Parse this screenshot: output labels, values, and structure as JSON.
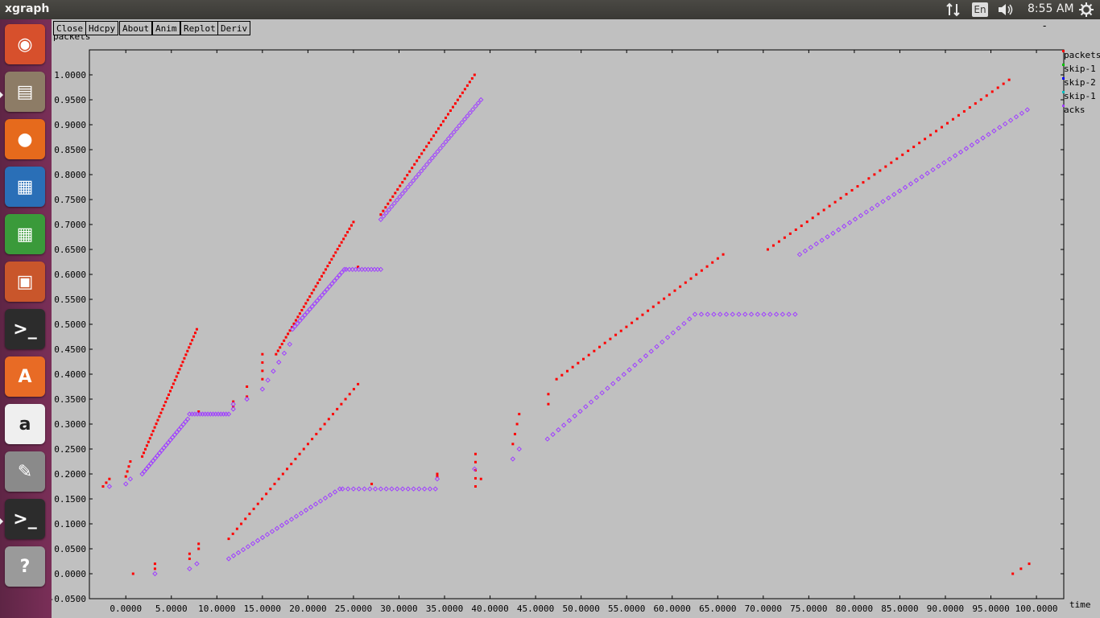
{
  "window": {
    "title": "xgraph"
  },
  "tray": {
    "keyboard": "En",
    "clock": "8:55 AM"
  },
  "launcher": {
    "items": [
      {
        "name": "ubuntu-dash-icon",
        "color": "#d7502c"
      },
      {
        "name": "files-icon",
        "color": "#8d7c66"
      },
      {
        "name": "firefox-icon",
        "color": "#e66a1c"
      },
      {
        "name": "writer-icon",
        "color": "#2a6fb7"
      },
      {
        "name": "calc-icon",
        "color": "#3a9a3a"
      },
      {
        "name": "impress-icon",
        "color": "#c9562b"
      },
      {
        "name": "terminal-icon",
        "color": "#2c2c2c"
      },
      {
        "name": "software-center-icon",
        "color": "#e86b25"
      },
      {
        "name": "amazon-icon",
        "color": "#efefef"
      },
      {
        "name": "system-settings-icon",
        "color": "#8a8a8a"
      },
      {
        "name": "terminal-icon-2",
        "color": "#2c2c2c"
      },
      {
        "name": "help-icon",
        "color": "#9a9a9a"
      }
    ]
  },
  "buttons": {
    "close": "Close",
    "hdcpy": "Hdcpy",
    "about": "About",
    "anim": "Anim",
    "replot": "Replot",
    "deriv": "Deriv"
  },
  "minimize_mark": "-",
  "chart_data": {
    "type": "scatter",
    "ylabel": "packets",
    "xlabel": "time",
    "xlim": [
      -4.0,
      103.0
    ],
    "ylim": [
      -0.05,
      1.05
    ],
    "x_ticks": [
      "0.0000",
      "5.0000",
      "10.0000",
      "15.0000",
      "20.0000",
      "25.0000",
      "30.0000",
      "35.0000",
      "40.0000",
      "45.0000",
      "50.0000",
      "55.0000",
      "60.0000",
      "65.0000",
      "70.0000",
      "75.0000",
      "80.0000",
      "85.0000",
      "90.0000",
      "95.0000",
      "100.0000"
    ],
    "x_tick_values": [
      0,
      5,
      10,
      15,
      20,
      25,
      30,
      35,
      40,
      45,
      50,
      55,
      60,
      65,
      70,
      75,
      80,
      85,
      90,
      95,
      100
    ],
    "y_ticks": [
      "-0.0500",
      "0.0000",
      "0.0500",
      "0.1000",
      "0.1500",
      "0.2000",
      "0.2500",
      "0.3000",
      "0.3500",
      "0.4000",
      "0.4500",
      "0.5000",
      "0.5500",
      "0.6000",
      "0.6500",
      "0.7000",
      "0.7500",
      "0.8000",
      "0.8500",
      "0.9000",
      "0.9500",
      "1.0000"
    ],
    "y_tick_values": [
      -0.05,
      0,
      0.05,
      0.1,
      0.15,
      0.2,
      0.25,
      0.3,
      0.35,
      0.4,
      0.45,
      0.5,
      0.55,
      0.6,
      0.65,
      0.7,
      0.75,
      0.8,
      0.85,
      0.9,
      0.95,
      1.0
    ],
    "legend": [
      {
        "name": "packets",
        "color": "#ff0000"
      },
      {
        "name": "skip-1",
        "color": "#00c000"
      },
      {
        "name": "skip-2",
        "color": "#0000ff"
      },
      {
        "name": "skip-1",
        "color": "#00c0c0"
      },
      {
        "name": "acks",
        "color": "#a040ff"
      }
    ],
    "legend_position": "right",
    "series": [
      {
        "name": "packets",
        "color": "#ff0000",
        "marker": "square",
        "segments": [
          {
            "x0": -2.5,
            "y0": 0.175,
            "x1": -1.8,
            "y1": 0.19,
            "n": 3
          },
          {
            "x0": 0.0,
            "y0": 0.195,
            "x1": 0.5,
            "y1": 0.225,
            "n": 4
          },
          {
            "x0": 1.8,
            "y0": 0.235,
            "x1": 7.8,
            "y1": 0.49,
            "n": 36
          },
          {
            "x0": 8.0,
            "y0": 0.325,
            "x1": 8.0,
            "y1": 0.325,
            "n": 1
          },
          {
            "x0": 0.8,
            "y0": 0.0,
            "x1": 0.8,
            "y1": 0.0,
            "n": 1
          },
          {
            "x0": 3.2,
            "y0": 0.01,
            "x1": 3.2,
            "y1": 0.02,
            "n": 2
          },
          {
            "x0": 7.0,
            "y0": 0.03,
            "x1": 7.0,
            "y1": 0.04,
            "n": 2
          },
          {
            "x0": 8.0,
            "y0": 0.05,
            "x1": 8.0,
            "y1": 0.06,
            "n": 2
          },
          {
            "x0": 11.3,
            "y0": 0.07,
            "x1": 25.5,
            "y1": 0.38,
            "n": 32
          },
          {
            "x0": 11.8,
            "y0": 0.335,
            "x1": 11.8,
            "y1": 0.345,
            "n": 2
          },
          {
            "x0": 13.3,
            "y0": 0.355,
            "x1": 13.3,
            "y1": 0.375,
            "n": 2
          },
          {
            "x0": 15.0,
            "y0": 0.39,
            "x1": 15.0,
            "y1": 0.44,
            "n": 4
          },
          {
            "x0": 16.5,
            "y0": 0.44,
            "x1": 25.0,
            "y1": 0.705,
            "n": 40
          },
          {
            "x0": 25.5,
            "y0": 0.615,
            "x1": 25.5,
            "y1": 0.615,
            "n": 1
          },
          {
            "x0": 28.0,
            "y0": 0.72,
            "x1": 38.3,
            "y1": 1.0,
            "n": 40
          },
          {
            "x0": 27.0,
            "y0": 0.18,
            "x1": 27.0,
            "y1": 0.18,
            "n": 1
          },
          {
            "x0": 34.2,
            "y0": 0.195,
            "x1": 34.2,
            "y1": 0.2,
            "n": 2
          },
          {
            "x0": 38.4,
            "y0": 0.175,
            "x1": 38.4,
            "y1": 0.24,
            "n": 5
          },
          {
            "x0": 39.0,
            "y0": 0.19,
            "x1": 39.0,
            "y1": 0.19,
            "n": 1
          },
          {
            "x0": 42.5,
            "y0": 0.26,
            "x1": 43.2,
            "y1": 0.32,
            "n": 4
          },
          {
            "x0": 46.4,
            "y0": 0.34,
            "x1": 46.4,
            "y1": 0.36,
            "n": 2
          },
          {
            "x0": 47.3,
            "y0": 0.39,
            "x1": 65.6,
            "y1": 0.64,
            "n": 32
          },
          {
            "x0": 70.5,
            "y0": 0.65,
            "x1": 97.0,
            "y1": 0.99,
            "n": 44
          },
          {
            "x0": 97.4,
            "y0": 0.0,
            "x1": 99.2,
            "y1": 0.02,
            "n": 3
          }
        ]
      },
      {
        "name": "acks",
        "color": "#a040ff",
        "marker": "diamond",
        "segments": [
          {
            "x0": -1.8,
            "y0": 0.175,
            "x1": -1.8,
            "y1": 0.175,
            "n": 1
          },
          {
            "x0": 0.0,
            "y0": 0.18,
            "x1": 0.5,
            "y1": 0.19,
            "n": 2
          },
          {
            "x0": 1.8,
            "y0": 0.2,
            "x1": 6.8,
            "y1": 0.31,
            "n": 22
          },
          {
            "x0": 7.0,
            "y0": 0.32,
            "x1": 11.3,
            "y1": 0.32,
            "n": 16
          },
          {
            "x0": 11.8,
            "y0": 0.33,
            "x1": 11.8,
            "y1": 0.34,
            "n": 2
          },
          {
            "x0": 3.2,
            "y0": 0.0,
            "x1": 3.2,
            "y1": 0.0,
            "n": 1
          },
          {
            "x0": 7.0,
            "y0": 0.01,
            "x1": 7.0,
            "y1": 0.01,
            "n": 1
          },
          {
            "x0": 7.8,
            "y0": 0.02,
            "x1": 7.8,
            "y1": 0.02,
            "n": 1
          },
          {
            "x0": 11.3,
            "y0": 0.03,
            "x1": 23.5,
            "y1": 0.17,
            "n": 24
          },
          {
            "x0": 23.8,
            "y0": 0.17,
            "x1": 34.0,
            "y1": 0.17,
            "n": 18
          },
          {
            "x0": 34.2,
            "y0": 0.19,
            "x1": 34.2,
            "y1": 0.19,
            "n": 1
          },
          {
            "x0": 13.3,
            "y0": 0.35,
            "x1": 13.3,
            "y1": 0.35,
            "n": 1
          },
          {
            "x0": 15.0,
            "y0": 0.37,
            "x1": 18.0,
            "y1": 0.46,
            "n": 6
          },
          {
            "x0": 18.3,
            "y0": 0.49,
            "x1": 24.0,
            "y1": 0.61,
            "n": 22
          },
          {
            "x0": 24.2,
            "y0": 0.61,
            "x1": 28.0,
            "y1": 0.61,
            "n": 12
          },
          {
            "x0": 28.0,
            "y0": 0.71,
            "x1": 39.0,
            "y1": 0.95,
            "n": 38
          },
          {
            "x0": 38.3,
            "y0": 0.21,
            "x1": 38.3,
            "y1": 0.21,
            "n": 1
          },
          {
            "x0": 42.5,
            "y0": 0.23,
            "x1": 43.2,
            "y1": 0.25,
            "n": 2
          },
          {
            "x0": 46.3,
            "y0": 0.27,
            "x1": 62.5,
            "y1": 0.52,
            "n": 28
          },
          {
            "x0": 63.2,
            "y0": 0.52,
            "x1": 73.5,
            "y1": 0.52,
            "n": 16
          },
          {
            "x0": 74.0,
            "y0": 0.64,
            "x1": 99.0,
            "y1": 0.93,
            "n": 42
          }
        ]
      }
    ]
  }
}
